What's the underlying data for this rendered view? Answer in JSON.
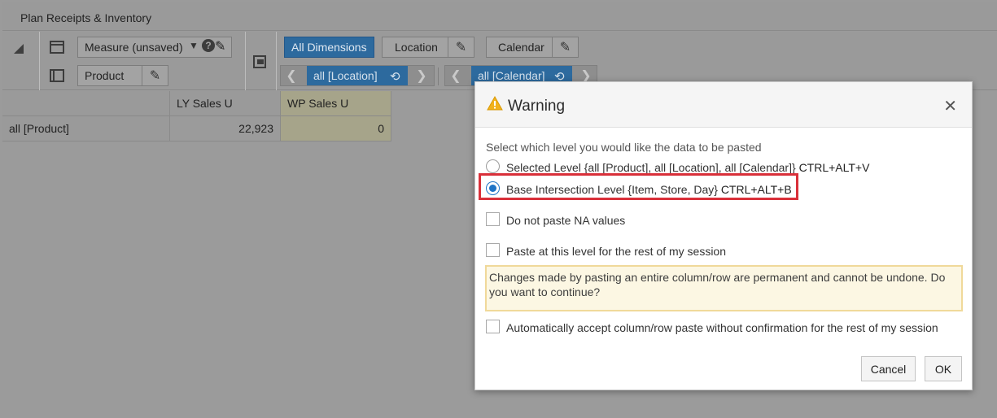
{
  "window": {
    "title": "Plan Receipts & Inventory"
  },
  "toolbar": {
    "measure_label": "Measure (unsaved)",
    "product_label": "Product",
    "all_dimensions_label": "All Dimensions",
    "location_label": "Location",
    "calendar_label": "Calendar",
    "location_nav": "all [Location]",
    "calendar_nav": "all [Calendar]"
  },
  "grid": {
    "columns": [
      "LY Sales U",
      "WP Sales U"
    ],
    "rows": [
      {
        "label": "all [Product]",
        "ly_sales_u": "22,923",
        "wp_sales_u": "0"
      }
    ]
  },
  "dialog": {
    "title": "Warning",
    "prompt": "Select which level you would like the data to be pasted",
    "options": [
      {
        "label": "Selected Level  {all [Product], all [Location], all [Calendar]}",
        "shortcut": "CTRL+ALT+V",
        "selected": false
      },
      {
        "label": "Base Intersection Level {Item, Store, Day}",
        "shortcut": "CTRL+ALT+B",
        "selected": true
      }
    ],
    "checkboxes": [
      {
        "label": "Do not paste NA values",
        "checked": false
      },
      {
        "label": "Paste at this level for the rest of my session",
        "checked": false
      },
      {
        "label": "Automatically accept column/row paste without confirmation for the rest of my session",
        "checked": false
      }
    ],
    "note": "Changes made by pasting an entire column/row are permanent and cannot be undone. Do you want to continue?",
    "cancel_label": "Cancel",
    "ok_label": "OK"
  },
  "colors": {
    "accent_blue": "#2d6a9e",
    "highlight_red": "#d9303a",
    "note_bg": "#fcf7e3"
  }
}
